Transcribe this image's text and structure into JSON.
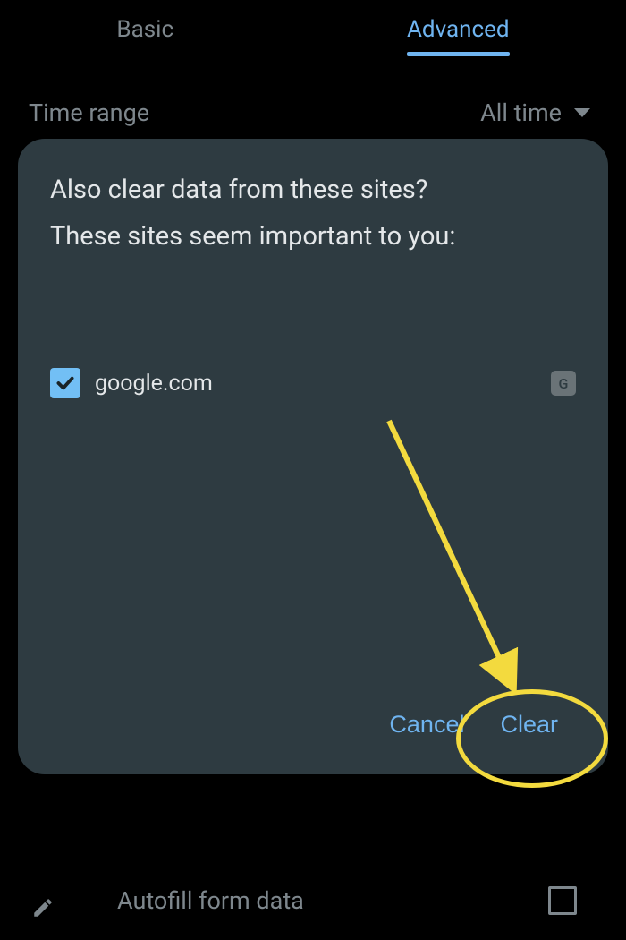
{
  "tabs": {
    "basic": "Basic",
    "advanced": "Advanced"
  },
  "timeRange": {
    "label": "Time range",
    "value": "All time"
  },
  "modal": {
    "line1": "Also clear data from these sites?",
    "line2": "These sites seem important to you:",
    "sites": [
      {
        "name": "google.com",
        "badge": "G",
        "checked": true
      }
    ],
    "cancel": "Cancel",
    "clear": "Clear"
  },
  "bottom": {
    "autofill": "Autofill form data"
  }
}
